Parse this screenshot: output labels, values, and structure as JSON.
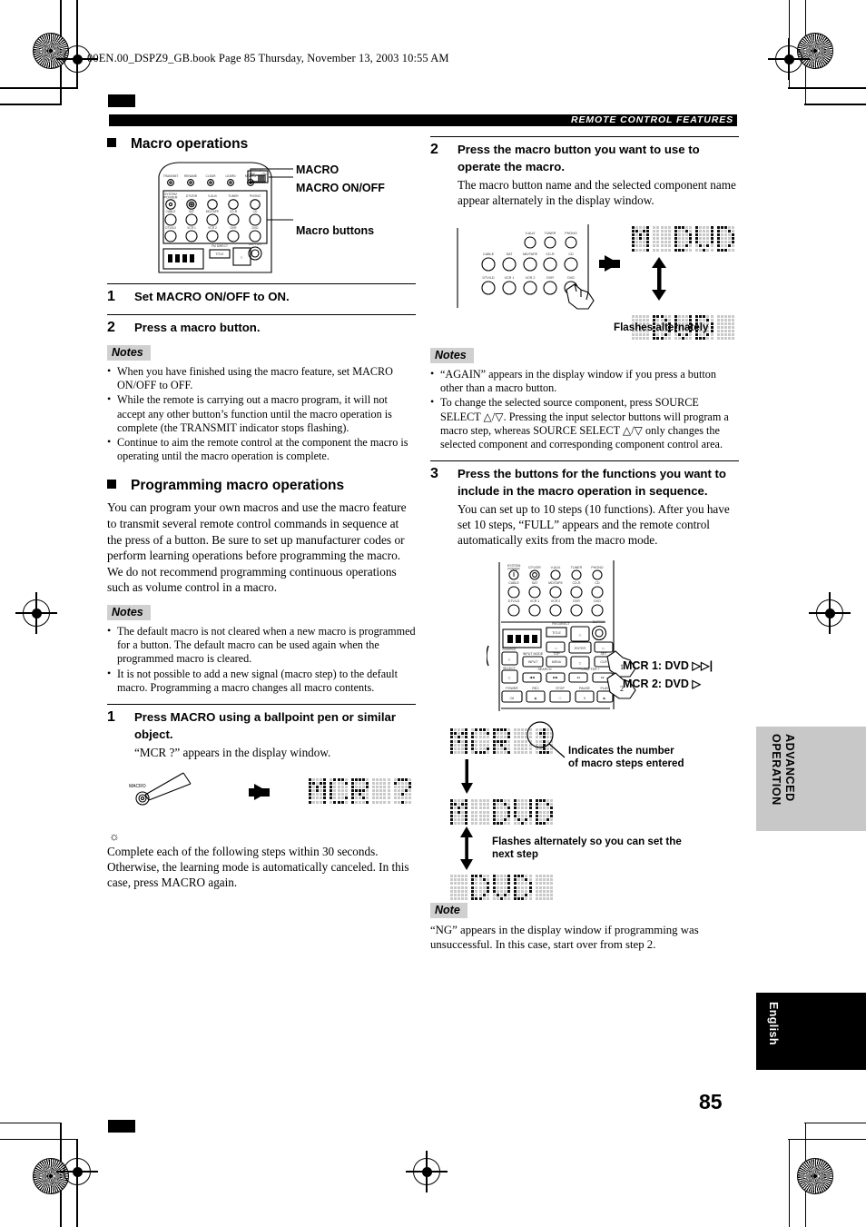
{
  "print": {
    "bookline": "00EN.00_DSPZ9_GB.book  Page 85  Thursday, November 13, 2003  10:55 AM"
  },
  "header": {
    "section_label": "REMOTE CONTROL FEATURES"
  },
  "left_column": {
    "heading": "Macro operations",
    "figure_callouts": [
      "MACRO",
      "MACRO ON/OFF",
      "Macro buttons"
    ],
    "remote_top_labels": [
      "TRANSMIT",
      "RENAME",
      "CLEAR",
      "LEARN",
      "MACRO"
    ],
    "remote_switch_labels": {
      "title": "MACRO",
      "off": "OFF",
      "on": "ON"
    },
    "remote_button_rows": [
      [
        "SYSTEM POWER",
        "DTV/CBL",
        "V-AUX",
        "TUNER",
        "PHONO"
      ],
      [
        "CABLE",
        "SAT",
        "MD/TAPE",
        "CD-R",
        "CD"
      ],
      [
        "DTV/LD",
        "VCR 1",
        "VCR 2",
        "DVR",
        "DVD"
      ]
    ],
    "steps": [
      {
        "num": "1",
        "title": "Set MACRO ON/OFF to ON."
      },
      {
        "num": "2",
        "title": "Press a macro button."
      }
    ],
    "notes_1_tag": "Notes",
    "notes_1": [
      "When you have finished using the macro feature, set MACRO ON/OFF to OFF.",
      "While the remote is carrying out a macro program, it will not accept any other button’s function until the macro operation is complete (the TRANSMIT indicator stops flashing).",
      "Continue to aim the remote control at the component the macro is operating until the macro operation is complete."
    ],
    "heading2": "Programming macro operations",
    "paragraph": "You can program your own macros and use the macro feature to transmit several remote control commands in sequence at the press of a button. Be sure to set up manufacturer codes or perform learning operations before programming the macro. We do not recommend programming continuous operations such as volume control in a macro.",
    "notes_2_tag": "Notes",
    "notes_2": [
      "The default macro is not cleared when a new macro is programmed for a button. The default macro can be used again when the programmed macro is cleared.",
      "It is not possible to add a new signal (macro step) to the default macro. Programming a macro changes all macro contents."
    ],
    "step_1": {
      "num": "1",
      "title": "Press MACRO using a ballpoint pen or similar object.",
      "desc": "“MCR ?” appears in the display window."
    },
    "pen_label": "MACRO",
    "lcd_mcr_question": "MCR ?",
    "tip": "Complete each of the following steps within 30 seconds. Otherwise, the learning mode is automatically canceled. In this case, press MACRO again."
  },
  "right_column": {
    "step_2": {
      "num": "2",
      "title": "Press the macro button you want to use to operate the macro.",
      "desc": "The macro button name and the selected component name appear alternately in the display window."
    },
    "figure_2": {
      "remote_rows": [
        [
          "",
          "",
          "V-AUX",
          "TUNER",
          "PHONO"
        ],
        [
          "CABLE",
          "SAT",
          "MD/TAPE",
          "CD-R",
          "CD"
        ],
        [
          "DTV/LD",
          "VCR 1",
          "VCR 2",
          "DVR",
          "DVD"
        ]
      ],
      "lcd_top": "M DVD",
      "lcd_bottom": " DVD ",
      "caption": "Flashes alternately"
    },
    "notes_tag": "Notes",
    "notes": [
      "“AGAIN” appears in the display window if you press a button other than a macro button.",
      "To change the selected source component, press SOURCE SELECT △/▽. Pressing the input selector buttons will program a macro step, whereas SOURCE SELECT △/▽ only changes the selected component and corresponding component control area."
    ],
    "step_3": {
      "num": "3",
      "title": "Press the buttons for the functions you want to include in the macro operation in sequence.",
      "desc": "You can set up to 10 steps (10 functions). After you have set 10 steps, “FULL” appears and the remote control automatically exits from the macro mode."
    },
    "figure_3": {
      "remote_rows": [
        [
          "SYSTEM POWER",
          "DTV/DR",
          "V-AUX",
          "TUNER",
          "PHONO"
        ],
        [
          "CABLE",
          "SAT",
          "MD/TAPE",
          "CD-R",
          "CD"
        ],
        [
          "DTV/LD",
          "VCR 1",
          "VCR 2",
          "DVR",
          "DVD"
        ]
      ],
      "keypad_labels": [
        "TITLE",
        "MENU",
        "ENTER",
        "SOURCE",
        "SELECT",
        "INPUT",
        "TOP",
        "SET",
        "CLR",
        "SEARCH",
        "CHAPTER",
        "POWER",
        "REC",
        "STOP",
        "PAUSE",
        "PLAY",
        "FM DIRECT",
        "BUTTON"
      ],
      "callout_1": "MCR 1: DVD ▷▷|",
      "callout_2": "MCR 2: DVD ▷",
      "marker_1": "1",
      "marker_2": "2"
    },
    "figure_4": {
      "lcd_1": "MCR 1",
      "lcd_2": "M DVD",
      "lcd_3": " DVD ",
      "caption_1": "Indicates the number of macro steps entered",
      "caption_2": "Flashes alternately so you can set the next step"
    },
    "note_tag": "Note",
    "note": "“NG” appears in the display window if programming was unsuccessful. In this case, start over from step 2."
  },
  "side_tabs": {
    "advanced": "ADVANCED\nOPERATION",
    "advanced_line1": "ADVANCED",
    "advanced_line2": "OPERATION",
    "english": "English"
  },
  "page_number": "85"
}
